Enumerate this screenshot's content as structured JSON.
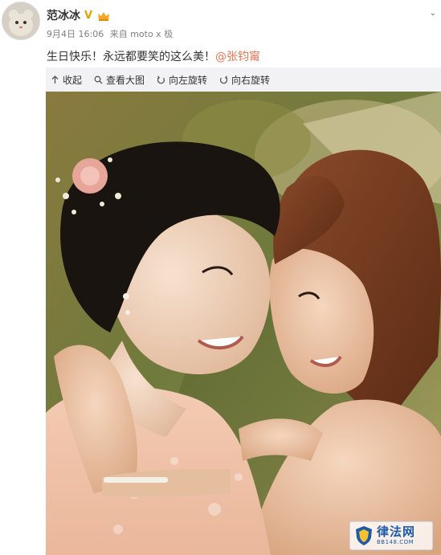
{
  "user": {
    "name": "范冰冰",
    "verified_icon": "verified-v-icon",
    "vip_icon": "vip-crown-icon"
  },
  "meta": {
    "date": "9月4日 16:06",
    "source": "来自 moto x 极"
  },
  "post": {
    "text": "生日快乐！永远都要笑的这么美！",
    "mention": "@张钧甯"
  },
  "toolbar": {
    "collapse": "收起",
    "view_large": "查看大图",
    "rotate_left": "向左旋转",
    "rotate_right": "向右旋转"
  },
  "watermark": {
    "title": "律法网",
    "url": "BB148.COM"
  },
  "colors": {
    "mention": "#eb7350",
    "meta": "#808080",
    "media_bg": "#f2f2f5",
    "watermark_blue": "#1e5aa8"
  }
}
